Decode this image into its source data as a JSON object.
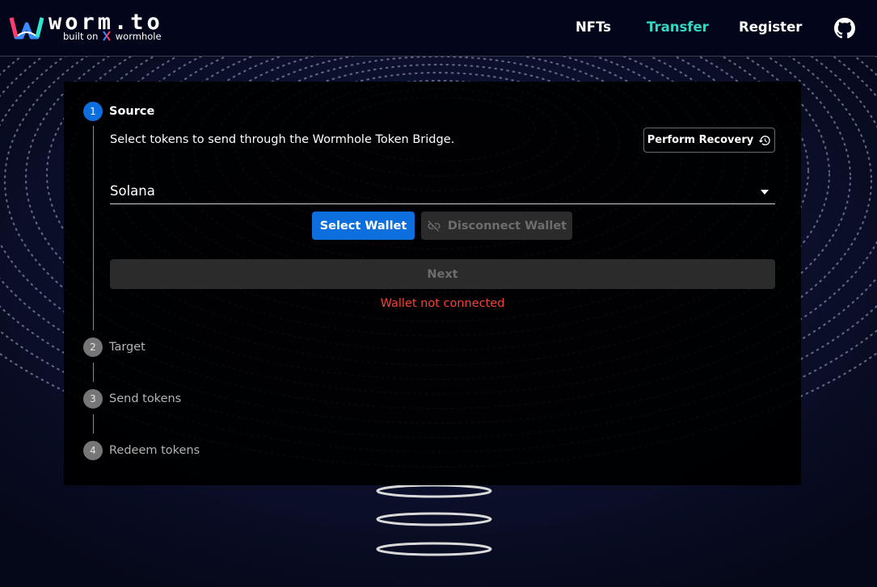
{
  "header": {
    "logo": {
      "wordmark": "worm.to",
      "subtitle_prefix": "built on",
      "subtitle_brand": "wormhole"
    },
    "nav": {
      "nfts": "NFTs",
      "transfer": "Transfer",
      "register": "Register"
    },
    "active_nav_color": "#35d7c2",
    "github_icon": "github-icon"
  },
  "stepper": {
    "steps": [
      {
        "number": "1",
        "label": "Source",
        "active": true
      },
      {
        "number": "2",
        "label": "Target",
        "active": false
      },
      {
        "number": "3",
        "label": "Send tokens",
        "active": false
      },
      {
        "number": "4",
        "label": "Redeem tokens",
        "active": false
      }
    ]
  },
  "source": {
    "description": "Select tokens to send through the Wormhole Token Bridge.",
    "recovery_button": "Perform Recovery",
    "recovery_icon": "history-icon",
    "chain_value": "Solana",
    "select_wallet_button": "Select Wallet",
    "disconnect_wallet_button": "Disconnect Wallet",
    "disconnect_icon": "link-off-icon",
    "next_button": "Next",
    "error_message": "Wallet not connected"
  },
  "colors": {
    "primary": "#0d6ede",
    "error": "#f44336",
    "accent": "#35d7c2"
  }
}
